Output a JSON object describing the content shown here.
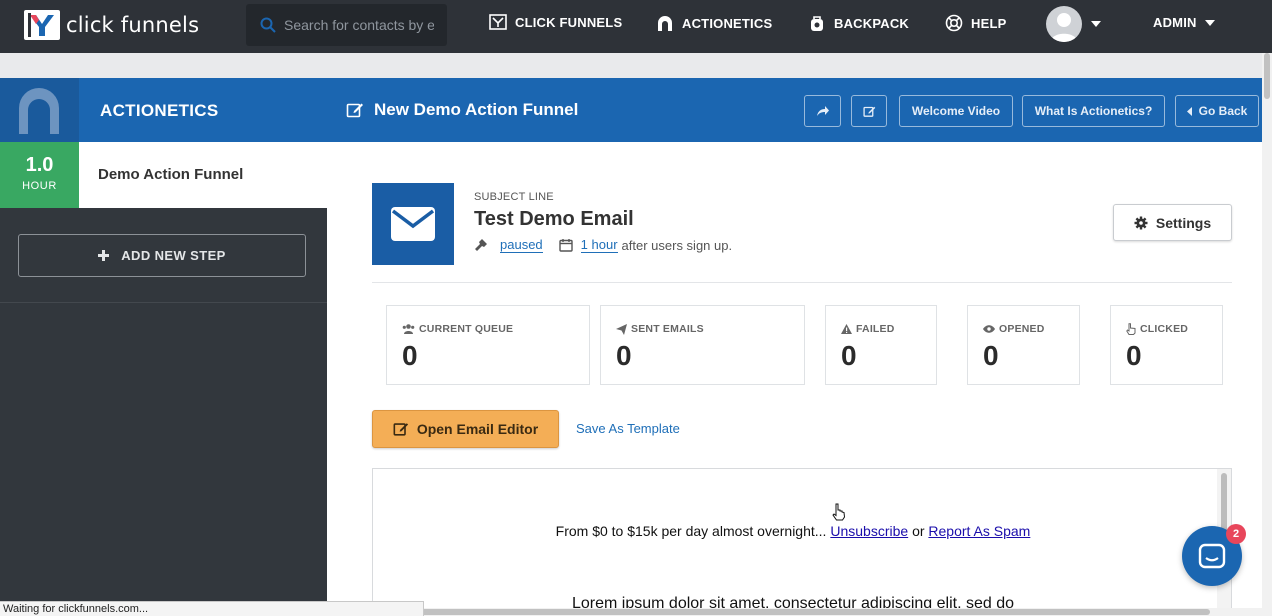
{
  "topnav": {
    "logo_text": "click funnels",
    "search_placeholder": "Search for contacts by e",
    "items": [
      {
        "label": "CLICK FUNNELS",
        "icon": "clickfunnels-icon"
      },
      {
        "label": "ACTIONETICS",
        "icon": "actionetics-icon"
      },
      {
        "label": "BACKPACK",
        "icon": "backpack-icon"
      },
      {
        "label": "HELP",
        "icon": "lifebuoy-icon"
      }
    ],
    "user_label": "ADMIN"
  },
  "header": {
    "section_title": "ACTIONETICS",
    "funnel_title": "New Demo Action Funnel",
    "buttons": {
      "welcome_video": "Welcome Video",
      "what_is": "What Is Actionetics?",
      "go_back": "Go Back"
    }
  },
  "sidebar": {
    "step": {
      "delay_value": "1.0",
      "delay_unit": "HOUR",
      "name": "Demo Action Funnel"
    },
    "add_step_label": "ADD NEW STEP"
  },
  "email": {
    "subject_label": "SUBJECT LINE",
    "title": "Test Demo Email",
    "status": "paused",
    "delay": "1 hour",
    "delay_suffix": "after users sign up.",
    "settings_label": "Settings"
  },
  "stats": [
    {
      "label": "CURRENT QUEUE",
      "value": "0",
      "icon": "users-icon"
    },
    {
      "label": "SENT EMAILS",
      "value": "0",
      "icon": "paper-plane-icon"
    },
    {
      "label": "FAILED",
      "value": "0",
      "icon": "warning-icon"
    },
    {
      "label": "OPENED",
      "value": "0",
      "icon": "eye-icon"
    },
    {
      "label": "CLICKED",
      "value": "0",
      "icon": "hand-pointer-icon"
    }
  ],
  "actions": {
    "open_editor": "Open Email Editor",
    "save_template": "Save As Template"
  },
  "preview": {
    "intro": "From $0 to $15k per day almost overnight...",
    "unsubscribe": "Unsubscribe",
    "or": "or",
    "report_spam": "Report As Spam",
    "body_start": "Lorem ipsum dolor sit amet, consectetur adipiscing elit, sed do"
  },
  "chat": {
    "unread_count": "2"
  },
  "browser_status": "Waiting for clickfunnels.com...",
  "colors": {
    "nav_bg": "#2e3238",
    "header_blue": "#1b66b1",
    "badge_green": "#39a862",
    "editor_orange": "#f4ae56",
    "link_blue": "#1f6fb8",
    "chat_badge": "#e8465b"
  }
}
